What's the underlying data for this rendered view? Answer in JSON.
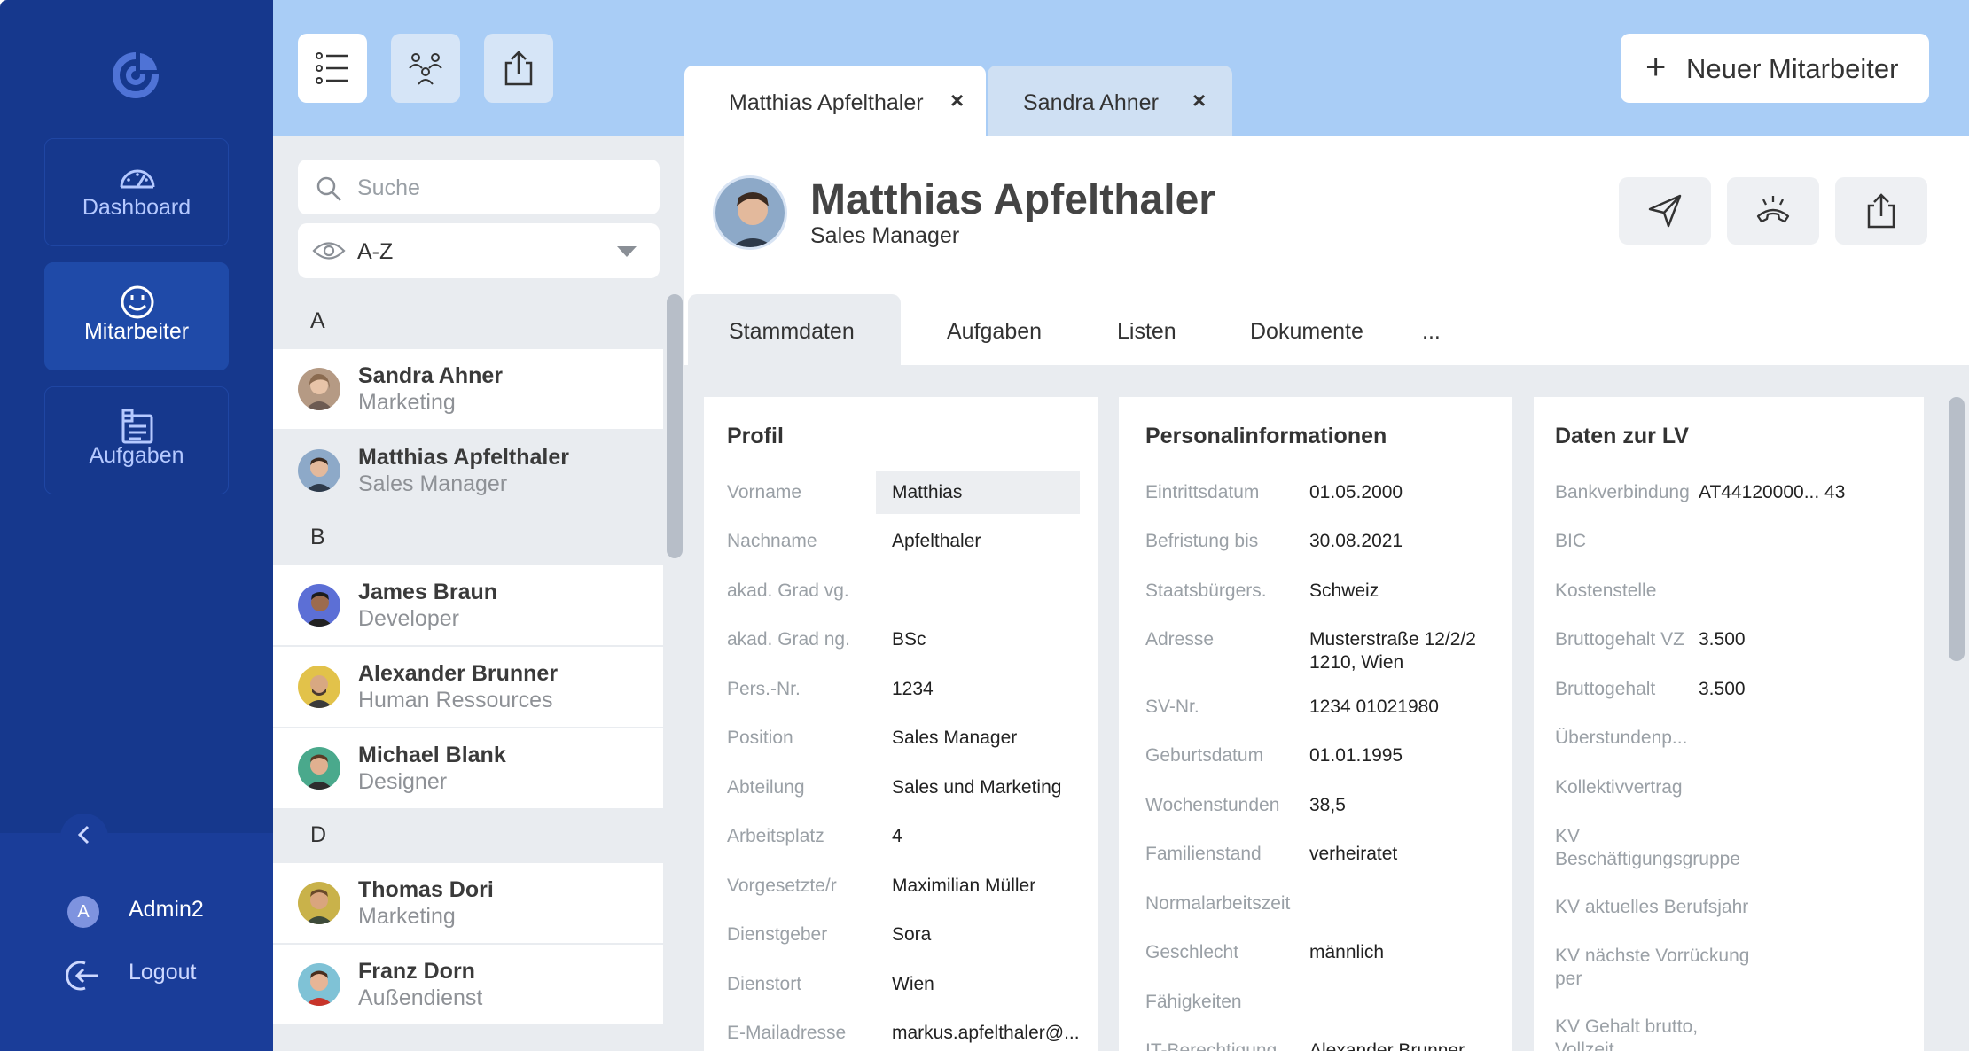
{
  "sidebar": {
    "nav": [
      {
        "label": "Dashboard",
        "icon": "gauge-icon"
      },
      {
        "label": "Mitarbeiter",
        "icon": "smile-icon"
      },
      {
        "label": "Aufgaben",
        "icon": "clipboard-icon"
      }
    ],
    "user": {
      "initial": "A",
      "name": "Admin2"
    },
    "logout_label": "Logout"
  },
  "toolbar": {
    "icons": [
      "list-view-icon",
      "team-view-icon",
      "export-icon"
    ],
    "new_employee_label": "Neuer Mitarbeiter"
  },
  "open_tabs": [
    {
      "label": "Matthias Apfelthaler",
      "close": "×"
    },
    {
      "label": "Sandra Ahner",
      "close": "×"
    }
  ],
  "list": {
    "search_placeholder": "Suche",
    "sort_value": "A-Z",
    "groups": [
      {
        "letter": "A",
        "people": [
          {
            "name": "Sandra Ahner",
            "role": "Marketing"
          },
          {
            "name": "Matthias Apfelthaler",
            "role": "Sales Manager"
          }
        ]
      },
      {
        "letter": "B",
        "people": [
          {
            "name": "James Braun",
            "role": "Developer"
          },
          {
            "name": "Alexander Brunner",
            "role": "Human Ressources"
          },
          {
            "name": "Michael Blank",
            "role": "Designer"
          }
        ]
      },
      {
        "letter": "D",
        "people": [
          {
            "name": "Thomas Dori",
            "role": "Marketing"
          },
          {
            "name": "Franz Dorn",
            "role": "Außendienst"
          }
        ]
      }
    ]
  },
  "detail": {
    "name": "Matthias Apfelthaler",
    "role": "Sales Manager",
    "actions": [
      "send-icon",
      "phone-icon",
      "share-icon"
    ],
    "tabs": [
      "Stammdaten",
      "Aufgaben",
      "Listen",
      "Dokumente",
      "..."
    ],
    "profil": {
      "title": "Profil",
      "fields": [
        {
          "label": "Vorname",
          "value": "Matthias"
        },
        {
          "label": "Nachname",
          "value": "Apfelthaler"
        },
        {
          "label": "akad. Grad vg.",
          "value": ""
        },
        {
          "label": "akad. Grad ng.",
          "value": "BSc"
        },
        {
          "label": "Pers.-Nr.",
          "value": "1234"
        },
        {
          "label": "Position",
          "value": "Sales Manager"
        },
        {
          "label": "Abteilung",
          "value": "Sales und Marketing"
        },
        {
          "label": "Arbeitsplatz",
          "value": "4"
        },
        {
          "label": "Vorgesetzte/r",
          "value": "Maximilian Müller"
        },
        {
          "label": "Dienstgeber",
          "value": "Sora"
        },
        {
          "label": "Dienstort",
          "value": "Wien"
        },
        {
          "label": "E-Mailadresse",
          "value": "markus.apfelthaler@..."
        }
      ]
    },
    "personal": {
      "title": "Personalinformationen",
      "fields": [
        {
          "label": "Eintrittsdatum",
          "value": "01.05.2000"
        },
        {
          "label": "Befristung bis",
          "value": "30.08.2021"
        },
        {
          "label": "Staatsbürgers.",
          "value": "Schweiz"
        },
        {
          "label": "Adresse",
          "value": "Musterstraße 12/2/2",
          "value2": "1210, Wien"
        },
        {
          "label": "SV-Nr.",
          "value": "1234 01021980"
        },
        {
          "label": "Geburtsdatum",
          "value": "01.01.1995"
        },
        {
          "label": "Wochenstunden",
          "value": "38,5"
        },
        {
          "label": "Familienstand",
          "value": "verheiratet"
        },
        {
          "label": "Normalarbeitszeit",
          "value": ""
        },
        {
          "label": "Geschlecht",
          "value": "männlich"
        },
        {
          "label": "Fähigkeiten",
          "value": ""
        },
        {
          "label": "IT-Berechtigung",
          "value": "Alexander Brunner"
        }
      ]
    },
    "lv": {
      "title": "Daten zur LV",
      "fields": [
        {
          "label": "Bankverbindung",
          "value": "AT44120000... 43"
        },
        {
          "label": "BIC",
          "value": ""
        },
        {
          "label": "Kostenstelle",
          "value": ""
        },
        {
          "label": "Bruttogehalt VZ",
          "value": "3.500"
        },
        {
          "label": "Bruttogehalt",
          "value": "3.500"
        },
        {
          "label": "Überstundenp...",
          "value": ""
        },
        {
          "label": "Kollektivvertrag",
          "value": ""
        },
        {
          "label": "KV",
          "label2": "Beschäftigungsgruppe",
          "value": ""
        },
        {
          "label": "KV aktuelles Berufsjahr",
          "value": ""
        },
        {
          "label": "KV nächste Vorrückung",
          "label2": "per",
          "value": ""
        },
        {
          "label": "KV Gehalt brutto,",
          "label2": "Vollzeit",
          "value": ""
        }
      ]
    }
  },
  "colors": {
    "sidebar": "#16388d",
    "sidebar_active": "#1f4aa8",
    "topband": "#a9cdf6",
    "panel_grey": "#e9ecf0"
  }
}
